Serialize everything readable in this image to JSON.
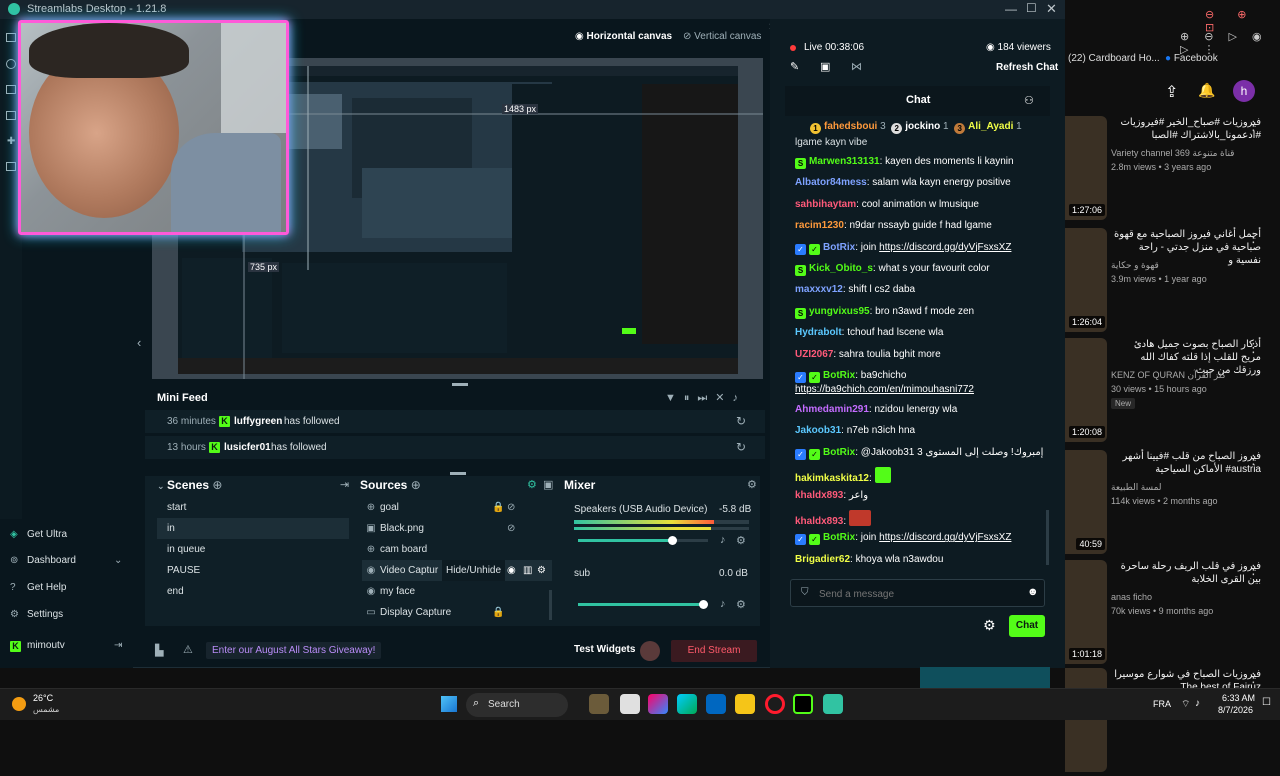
{
  "window": {
    "title": "Streamlabs Desktop - 1.21.8"
  },
  "canvas": {
    "horizontal_label": "Horizontal canvas",
    "vertical_label": "Vertical canvas"
  },
  "preview": {
    "measure_h": "1483 px",
    "measure_v": "735 px"
  },
  "minifeed": {
    "title": "Mini Feed",
    "items": [
      {
        "time": "36 minutes",
        "user": "luffygreen",
        "action": "has followed"
      },
      {
        "time": "13 hours",
        "user": "lusicfer01",
        "action": "has followed"
      }
    ]
  },
  "scenes": {
    "title": "Scenes",
    "items": [
      "start",
      "in",
      "in queue",
      "PAUSE",
      "end"
    ]
  },
  "sources": {
    "title": "Sources",
    "items": [
      "goal",
      "Black.png",
      "cam board",
      "Video Captur",
      "my face",
      "Display Capture"
    ],
    "tooltip": "Hide/Unhide"
  },
  "mixer": {
    "title": "Mixer",
    "channels": [
      {
        "name": "Speakers (USB Audio Device)",
        "db": "-5.8 dB",
        "level": 0.73
      },
      {
        "name": "sub",
        "db": "0.0 dB",
        "level": 0.97
      }
    ]
  },
  "sidebar": {
    "items": [
      "Get Ultra",
      "Dashboard",
      "Get Help",
      "Settings"
    ],
    "user": "mimoutv"
  },
  "bottombar": {
    "giveaway": "Enter our August All Stars Giveaway!",
    "test_widgets": "Test Widgets",
    "end_stream": "End Stream"
  },
  "live": {
    "status": "Live 00:38:06",
    "viewers": "184 viewers",
    "refresh": "Refresh Chat"
  },
  "chat": {
    "title": "Chat",
    "top": [
      {
        "rank": "1",
        "name": "fahedsboui",
        "count": "3"
      },
      {
        "rank": "2",
        "name": "jockino",
        "count": "1"
      },
      {
        "rank": "3",
        "name": "Ali_Ayadi",
        "count": "1"
      }
    ],
    "partial": "lgame kayn vibe",
    "messages": [
      {
        "user": "Marwen313131",
        "text": "kayen des moments li kaynin"
      },
      {
        "user": "Albator84mess",
        "text": "salam wla kayn energy positive"
      },
      {
        "user": "sahbihaytam",
        "text": "cool animation w lmusique"
      },
      {
        "user": "racim1230",
        "text": "n9dar nssayb guide f had lgame"
      },
      {
        "user": "BotRix",
        "text": "join ",
        "link": "https://discord.gg/dyVjFsxsXZ"
      },
      {
        "user": "Kick_Obito_s",
        "text": "what s your favourit color"
      },
      {
        "user": "maxxxv12",
        "text": "shift l cs2 daba"
      },
      {
        "user": "yungvixus95",
        "text": "bro n3awd f mode zen"
      },
      {
        "user": "Hydrabolt",
        "text": "tchouf had lscene wla"
      },
      {
        "user": "UZI2067",
        "text": "sahra toulia bghit more"
      },
      {
        "user": "BotRix",
        "text": "ba9chicho",
        "link": "https://ba9chich.com/en/mimouhasni772"
      },
      {
        "user": "Ahmedamin291",
        "text": "nzidou lenergy wla"
      },
      {
        "user": "Jakoob31",
        "text": "n7eb n3ich hna"
      },
      {
        "user": "BotRix",
        "text": "@Jakoob31 إمبروك! وصلت إلى المستوى 3"
      },
      {
        "user": "hakimkaskita12",
        "text": ""
      },
      {
        "user": "khaldx893",
        "text": "واعر"
      },
      {
        "user": "khaldx893",
        "text": ""
      },
      {
        "user": "BotRix",
        "text": "join ",
        "link": "https://discord.gg/dyVjFsxsXZ"
      },
      {
        "user": "Brigadier62",
        "text": "khoya wla n3awdou"
      }
    ],
    "placeholder": "Send a message",
    "send_label": "Chat"
  },
  "youtube": {
    "tab": "(22) Cardboard Ho...",
    "tab2": "Facebook",
    "avatar": "h",
    "items": [
      {
        "title": "فيروزيات #صباح_الخير #فيروزيات #ادعمونا_بالاشتراك #الصبا",
        "channel": "Variety channel 369 قناة متنوعة",
        "meta": "2.8m views • 3 years ago",
        "dur": "1:27:06"
      },
      {
        "title": "أجمل أغاني فيروز الصباحية مع قهوة صباحية في منزل جدتي - راحة نفسية و",
        "channel": "قهوة و حكاية",
        "meta": "3.9m views • 1 year ago",
        "dur": "1:26:04"
      },
      {
        "title": "أذكار الصباح بصوت جميل هادئ مريح للقلب إذا قلته كفاك الله ورزقك من حيث",
        "channel": "KENZ OF QURAN كنز القرآن",
        "meta": "30 views • 15 hours ago",
        "badge": "New",
        "dur": "1:20:08"
      },
      {
        "title": "فيروز الصباح من قلب #فيينا أشهر الأماكن السياحية #austria",
        "channel": "لمسة الطبيعة",
        "meta": "114k views • 2 months ago",
        "dur": "40:59"
      },
      {
        "title": "فيروز في قلب الريف رحلة ساحرة بين القرى الخلابة",
        "channel": "anas ficho",
        "meta": "70k views • 9 months ago",
        "dur": "1:01:18"
      },
      {
        "title": "فيروزيات الصباح في شوارع موسيرا The best of Fairuz",
        "channel": "",
        "meta": "",
        "dur": ""
      }
    ]
  },
  "taskbar": {
    "temp": "26°C",
    "weather": "مشمس",
    "search": "Search",
    "lang": "FRA",
    "time": "6:33 AM",
    "date": "8/7/2026"
  },
  "colors": {
    "accent": "#53fc18",
    "live": "#ff3b3b",
    "end_stream": "#ff5a6a",
    "bg": "#09161d"
  }
}
